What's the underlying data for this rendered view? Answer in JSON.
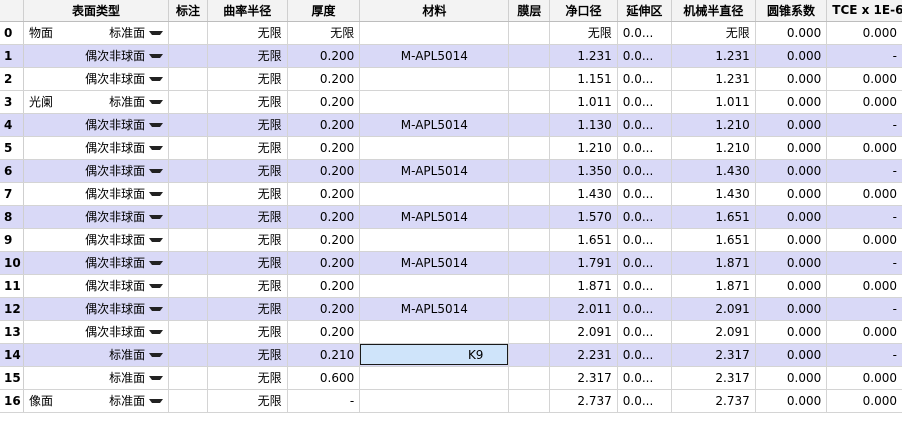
{
  "headers": [
    "",
    "表面类型",
    "标注",
    "曲率半径",
    "厚度",
    "材料",
    "膜层",
    "净口径",
    "延伸区",
    "机械半直径",
    "圆锥系数",
    "TCE x 1E-6"
  ],
  "rows": [
    {
      "idx": "0",
      "comment": "物面",
      "type": "标准面",
      "label": "",
      "radius": "无限",
      "thickness": "无限",
      "material": "",
      "coating": "",
      "clear": "无限",
      "ext": "0.0...",
      "mech": "无限",
      "conic": "0.000",
      "tce": "0.000",
      "alt": false
    },
    {
      "idx": "1",
      "comment": "",
      "type": "偶次非球面",
      "label": "",
      "radius": "无限",
      "thickness": "0.200",
      "material": "M-APL5014",
      "coating": "",
      "clear": "1.231",
      "ext": "0.0...",
      "mech": "1.231",
      "conic": "0.000",
      "tce": "-",
      "alt": true
    },
    {
      "idx": "2",
      "comment": "",
      "type": "偶次非球面",
      "label": "",
      "radius": "无限",
      "thickness": "0.200",
      "material": "",
      "coating": "",
      "clear": "1.151",
      "ext": "0.0...",
      "mech": "1.231",
      "conic": "0.000",
      "tce": "0.000",
      "alt": false
    },
    {
      "idx": "3",
      "comment": "光阑",
      "type": "标准面",
      "label": "",
      "radius": "无限",
      "thickness": "0.200",
      "material": "",
      "coating": "",
      "clear": "1.011",
      "ext": "0.0...",
      "mech": "1.011",
      "conic": "0.000",
      "tce": "0.000",
      "alt": false
    },
    {
      "idx": "4",
      "comment": "",
      "type": "偶次非球面",
      "label": "",
      "radius": "无限",
      "thickness": "0.200",
      "material": "M-APL5014",
      "coating": "",
      "clear": "1.130",
      "ext": "0.0...",
      "mech": "1.210",
      "conic": "0.000",
      "tce": "-",
      "alt": true
    },
    {
      "idx": "5",
      "comment": "",
      "type": "偶次非球面",
      "label": "",
      "radius": "无限",
      "thickness": "0.200",
      "material": "",
      "coating": "",
      "clear": "1.210",
      "ext": "0.0...",
      "mech": "1.210",
      "conic": "0.000",
      "tce": "0.000",
      "alt": false
    },
    {
      "idx": "6",
      "comment": "",
      "type": "偶次非球面",
      "label": "",
      "radius": "无限",
      "thickness": "0.200",
      "material": "M-APL5014",
      "coating": "",
      "clear": "1.350",
      "ext": "0.0...",
      "mech": "1.430",
      "conic": "0.000",
      "tce": "-",
      "alt": true
    },
    {
      "idx": "7",
      "comment": "",
      "type": "偶次非球面",
      "label": "",
      "radius": "无限",
      "thickness": "0.200",
      "material": "",
      "coating": "",
      "clear": "1.430",
      "ext": "0.0...",
      "mech": "1.430",
      "conic": "0.000",
      "tce": "0.000",
      "alt": false
    },
    {
      "idx": "8",
      "comment": "",
      "type": "偶次非球面",
      "label": "",
      "radius": "无限",
      "thickness": "0.200",
      "material": "M-APL5014",
      "coating": "",
      "clear": "1.570",
      "ext": "0.0...",
      "mech": "1.651",
      "conic": "0.000",
      "tce": "-",
      "alt": true
    },
    {
      "idx": "9",
      "comment": "",
      "type": "偶次非球面",
      "label": "",
      "radius": "无限",
      "thickness": "0.200",
      "material": "",
      "coating": "",
      "clear": "1.651",
      "ext": "0.0...",
      "mech": "1.651",
      "conic": "0.000",
      "tce": "0.000",
      "alt": false
    },
    {
      "idx": "10",
      "comment": "",
      "type": "偶次非球面",
      "label": "",
      "radius": "无限",
      "thickness": "0.200",
      "material": "M-APL5014",
      "coating": "",
      "clear": "1.791",
      "ext": "0.0...",
      "mech": "1.871",
      "conic": "0.000",
      "tce": "-",
      "alt": true
    },
    {
      "idx": "11",
      "comment": "",
      "type": "偶次非球面",
      "label": "",
      "radius": "无限",
      "thickness": "0.200",
      "material": "",
      "coating": "",
      "clear": "1.871",
      "ext": "0.0...",
      "mech": "1.871",
      "conic": "0.000",
      "tce": "0.000",
      "alt": false
    },
    {
      "idx": "12",
      "comment": "",
      "type": "偶次非球面",
      "label": "",
      "radius": "无限",
      "thickness": "0.200",
      "material": "M-APL5014",
      "coating": "",
      "clear": "2.011",
      "ext": "0.0...",
      "mech": "2.091",
      "conic": "0.000",
      "tce": "-",
      "alt": true
    },
    {
      "idx": "13",
      "comment": "",
      "type": "偶次非球面",
      "label": "",
      "radius": "无限",
      "thickness": "0.200",
      "material": "",
      "coating": "",
      "clear": "2.091",
      "ext": "0.0...",
      "mech": "2.091",
      "conic": "0.000",
      "tce": "0.000",
      "alt": false
    },
    {
      "idx": "14",
      "comment": "",
      "type": "标准面",
      "label": "",
      "radius": "无限",
      "thickness": "0.210",
      "material": "K9",
      "coating": "",
      "clear": "2.231",
      "ext": "0.0...",
      "mech": "2.317",
      "conic": "0.000",
      "tce": "-",
      "alt": true,
      "selected_material": true
    },
    {
      "idx": "15",
      "comment": "",
      "type": "标准面",
      "label": "",
      "radius": "无限",
      "thickness": "0.600",
      "material": "",
      "coating": "",
      "clear": "2.317",
      "ext": "0.0...",
      "mech": "2.317",
      "conic": "0.000",
      "tce": "0.000",
      "alt": false
    },
    {
      "idx": "16",
      "comment": "像面",
      "type": "标准面",
      "label": "",
      "radius": "无限",
      "thickness": "-",
      "material": "",
      "coating": "",
      "clear": "2.737",
      "ext": "0.0...",
      "mech": "2.737",
      "conic": "0.000",
      "tce": "0.000",
      "alt": false
    }
  ],
  "colors": {
    "alt_row": "#d9d9f7",
    "selected_cell": "#cfe4fa",
    "header_bg": "#f3f3f3"
  },
  "icons": {
    "dropdown": "chevron-down-icon"
  }
}
